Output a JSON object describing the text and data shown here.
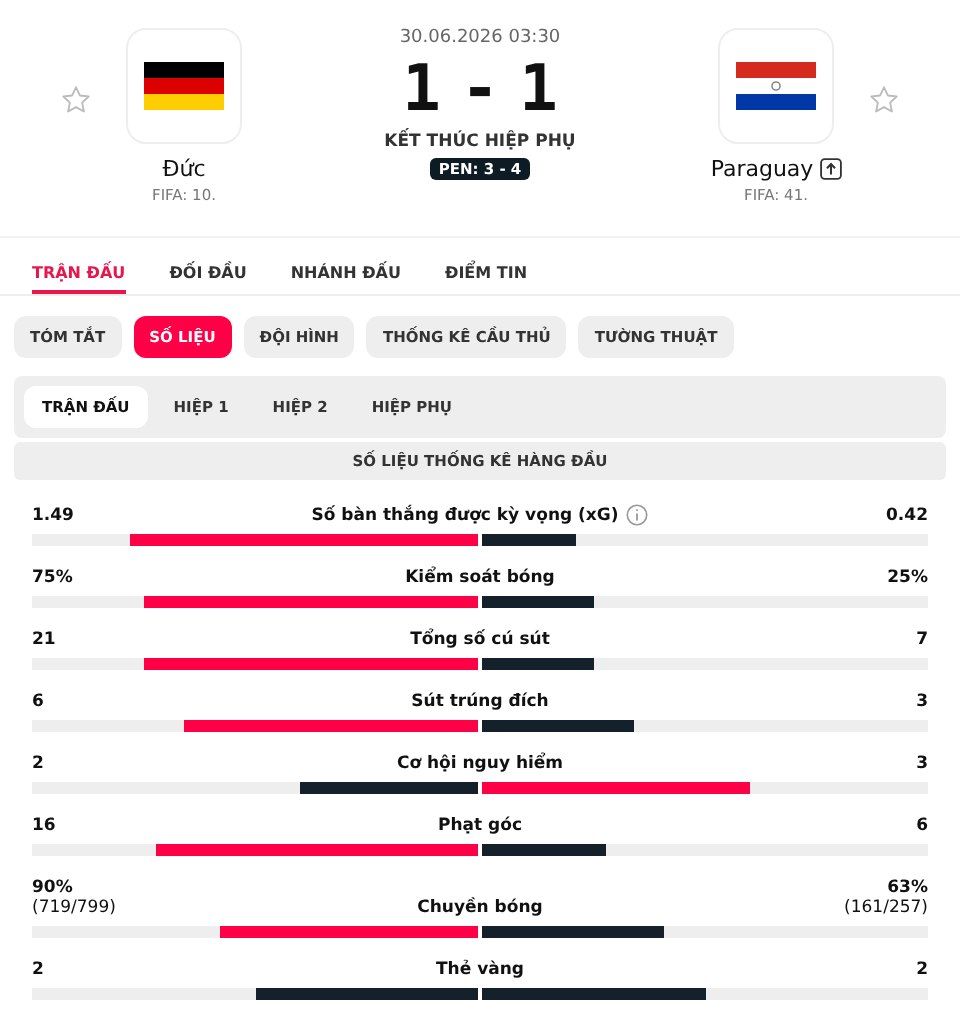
{
  "match": {
    "datetime": "30.06.2026 03:30",
    "score_home": "1",
    "score_separator": "-",
    "score_away": "1",
    "status": "KẾT THÚC HIỆP PHỤ",
    "penalties": "PEN: 3 - 4",
    "home": {
      "name": "Đức",
      "ranking": "FIFA: 10.",
      "favorite": false
    },
    "away": {
      "name": "Paraguay",
      "ranking": "FIFA: 41.",
      "favorite": false,
      "advanced": true
    }
  },
  "tabs": [
    {
      "label": "TRẬN ĐẤU",
      "selected": true
    },
    {
      "label": "ĐỐI ĐẦU",
      "selected": false
    },
    {
      "label": "NHÁNH ĐẤU",
      "selected": false
    },
    {
      "label": "ĐIỂM TIN",
      "selected": false
    }
  ],
  "chips": [
    {
      "label": "TÓM TẮT",
      "selected": false
    },
    {
      "label": "SỐ LIỆU",
      "selected": true
    },
    {
      "label": "ĐỘI HÌNH",
      "selected": false
    },
    {
      "label": "THỐNG KÊ CẦU THỦ",
      "selected": false
    },
    {
      "label": "TƯỜNG THUẬT",
      "selected": false
    }
  ],
  "periods": [
    {
      "label": "TRẬN ĐẤU",
      "selected": true
    },
    {
      "label": "HIỆP 1",
      "selected": false
    },
    {
      "label": "HIỆP 2",
      "selected": false
    },
    {
      "label": "HIỆP PHỤ",
      "selected": false
    }
  ],
  "section_title": "SỐ LIỆU THỐNG KÊ HÀNG ĐẦU",
  "stats": [
    {
      "name": "Số bàn thắng được kỳ vọng (xG)",
      "info": true,
      "home": {
        "value": "1.49",
        "level": 0.78,
        "highlighted": true
      },
      "away": {
        "value": "0.42",
        "level": 0.21,
        "highlighted": false
      }
    },
    {
      "name": "Kiểm soát bóng",
      "home": {
        "value": "75%",
        "level": 0.75,
        "highlighted": true
      },
      "away": {
        "value": "25%",
        "level": 0.25,
        "highlighted": false
      }
    },
    {
      "name": "Tổng số cú sút",
      "home": {
        "value": "21",
        "level": 0.75,
        "highlighted": true
      },
      "away": {
        "value": "7",
        "level": 0.25,
        "highlighted": false
      }
    },
    {
      "name": "Sút trúng đích",
      "home": {
        "value": "6",
        "level": 0.66,
        "highlighted": true
      },
      "away": {
        "value": "3",
        "level": 0.34,
        "highlighted": false
      }
    },
    {
      "name": "Cơ hội nguy hiểm",
      "home": {
        "value": "2",
        "level": 0.4,
        "highlighted": false
      },
      "away": {
        "value": "3",
        "level": 0.6,
        "highlighted": true
      }
    },
    {
      "name": "Phạt góc",
      "home": {
        "value": "16",
        "level": 0.72,
        "highlighted": true
      },
      "away": {
        "value": "6",
        "level": 0.28,
        "highlighted": false
      }
    },
    {
      "name": "Chuyền bóng",
      "home": {
        "value": "90%",
        "detail": "(719/799)",
        "level": 0.58,
        "highlighted": true
      },
      "away": {
        "value": "63%",
        "detail": "(161/257)",
        "level": 0.41,
        "highlighted": false
      }
    },
    {
      "name": "Thẻ vàng",
      "home": {
        "value": "2",
        "level": 0.5,
        "highlighted": false
      },
      "away": {
        "value": "2",
        "level": 0.5,
        "highlighted": false
      }
    }
  ]
}
